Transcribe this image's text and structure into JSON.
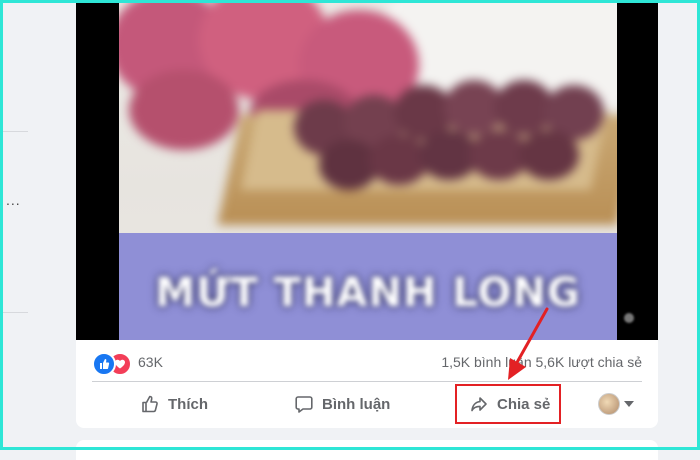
{
  "post": {
    "image": {
      "caption_text": "MỨT THANH LONG"
    },
    "stats": {
      "reaction_count": "63K",
      "comments_shares": "1,5K bình luận  5,6K lượt chia sẻ",
      "reactions": [
        "like-icon",
        "love-icon"
      ]
    },
    "actions": {
      "like_label": "Thích",
      "comment_label": "Bình luận",
      "share_label": "Chia sẻ"
    }
  },
  "left_sidebar": {
    "overflow_text": "..."
  },
  "colors": {
    "frame": "#2ee6d6",
    "highlight": "#e32124",
    "like_blue": "#1877f2",
    "love_red": "#f33e58",
    "band": "#8f8fd6"
  }
}
